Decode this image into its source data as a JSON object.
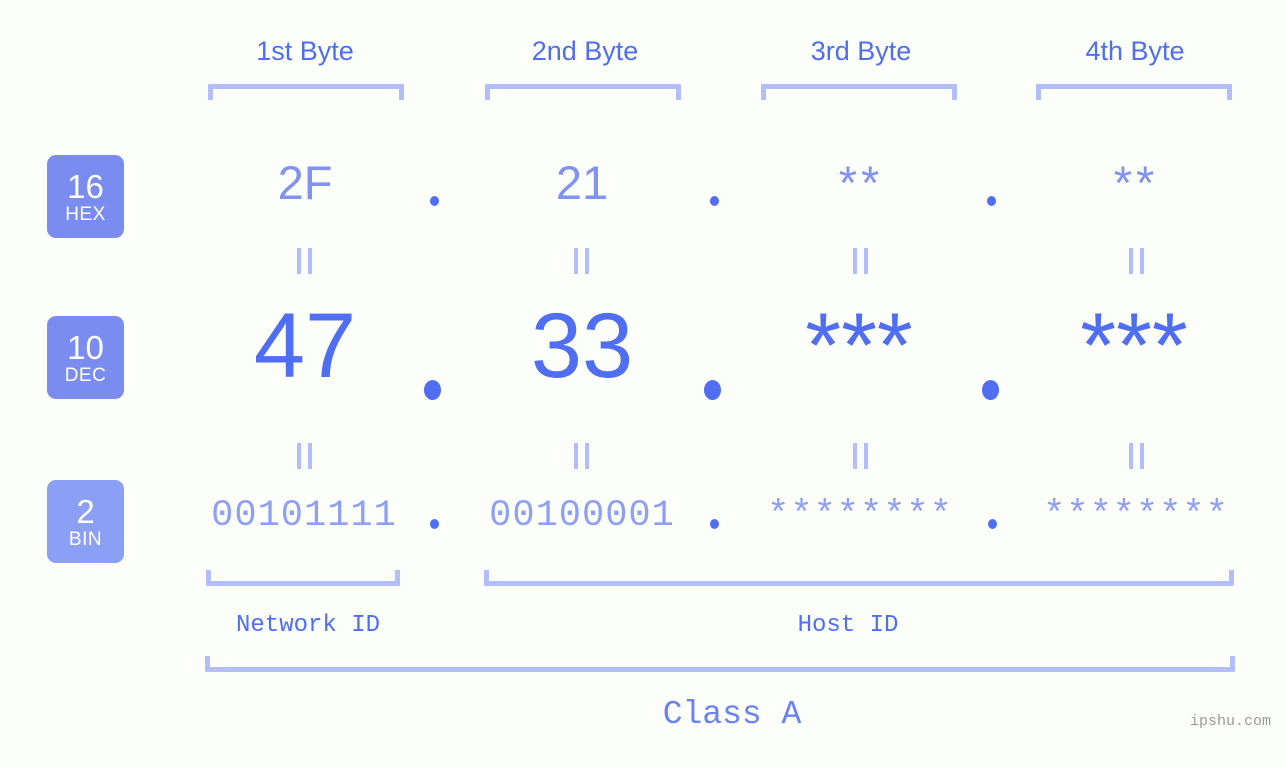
{
  "background_color": "#fcfefa",
  "accent_color": "#4f6ef2",
  "accent_light": "#8192f0",
  "bracket_color": "#b3bdf9",
  "byte_headers": [
    {
      "label": "1st Byte"
    },
    {
      "label": "2nd Byte"
    },
    {
      "label": "3rd Byte"
    },
    {
      "label": "4th Byte"
    }
  ],
  "rows": {
    "hex": {
      "badge_number": "16",
      "badge_name": "HEX",
      "values": [
        "2F",
        "21",
        "**",
        "**"
      ],
      "separator": "."
    },
    "dec": {
      "badge_number": "10",
      "badge_name": "DEC",
      "values": [
        "47",
        "33",
        "***",
        "***"
      ],
      "separator": "."
    },
    "bin": {
      "badge_number": "2",
      "badge_name": "BIN",
      "values": [
        "00101111",
        "00100001",
        "********",
        "********"
      ],
      "separator": "."
    }
  },
  "equality_marks": {
    "glyph": "||",
    "count_per_row": 4
  },
  "id_sections": [
    {
      "label": "Network ID"
    },
    {
      "label": "Host ID"
    }
  ],
  "class_section": {
    "label": "Class A"
  },
  "watermark": {
    "text": "ipshu.com"
  }
}
